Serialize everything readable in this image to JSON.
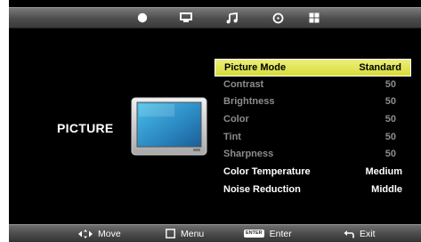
{
  "top_tabs": [
    {
      "icon": "picture-icon"
    },
    {
      "icon": "screen-icon"
    },
    {
      "icon": "music-note-icon"
    },
    {
      "icon": "clock-icon"
    },
    {
      "icon": "setup-grid-icon"
    }
  ],
  "section_title": "PICTURE",
  "menu": {
    "items": [
      {
        "label": "Picture Mode",
        "value": "Standard"
      },
      {
        "label": "Contrast",
        "value": "50"
      },
      {
        "label": "Brightness",
        "value": "50"
      },
      {
        "label": "Color",
        "value": "50"
      },
      {
        "label": "Tint",
        "value": "50"
      },
      {
        "label": "Sharpness",
        "value": "50"
      },
      {
        "label": "Color Temperature",
        "value": "Medium"
      },
      {
        "label": "Noise Reduction",
        "value": "Middle"
      }
    ]
  },
  "bottom_bar": {
    "move_label": "Move",
    "menu_label": "Menu",
    "enter_key": "ENTER",
    "enter_label": "Enter",
    "exit_label": "Exit"
  },
  "colors": {
    "highlight": "#dfe24a",
    "background": "#000000",
    "dim_text": "#8c8c8c"
  }
}
